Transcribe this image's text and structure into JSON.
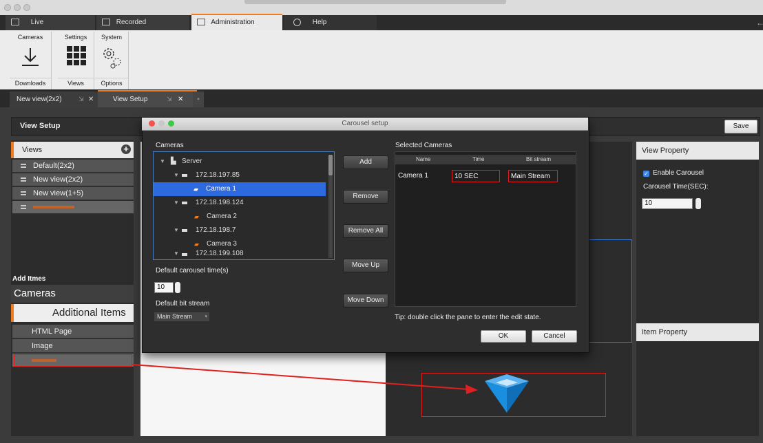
{
  "menu": {
    "tabs": [
      {
        "label": "Live"
      },
      {
        "label": "Recorded"
      },
      {
        "label": "Administration"
      },
      {
        "label": "Help"
      }
    ]
  },
  "ribbon": {
    "groups": [
      {
        "title": "Cameras",
        "icon": "download-icon",
        "footer": "Downloads"
      },
      {
        "title": "Settings",
        "icon": "views-grid-icon",
        "footer": "Views"
      },
      {
        "title": "System",
        "icon": "gears-icon",
        "footer": "Options"
      }
    ]
  },
  "doc_tabs": [
    {
      "label": "New view(2x2)"
    },
    {
      "label": "View Setup"
    }
  ],
  "view_setup": {
    "title": "View Setup",
    "save_label": "Save"
  },
  "left_panel": {
    "views_title": "Views",
    "views": [
      "Default(2x2)",
      "New view(2x2)",
      "New view(1+5)"
    ],
    "add_items_label": "Add Itmes",
    "cameras_label": "Cameras",
    "additional_items_label": "Additional Items",
    "additional_items": [
      "HTML Page",
      "Image"
    ]
  },
  "right_panel": {
    "view_property_title": "View Property",
    "enable_carousel_label": "Enable Carousel",
    "enable_carousel_checked": true,
    "carousel_time_label": "Carousel Time(SEC):",
    "carousel_time_value": "10",
    "item_property_title": "Item Property"
  },
  "dialog": {
    "title": "Carousel setup",
    "cameras_label": "Cameras",
    "tree": [
      {
        "label": "Server"
      },
      {
        "label": "172.18.197.85"
      },
      {
        "label": "Camera 1"
      },
      {
        "label": "172.18.198.124"
      },
      {
        "label": "Camera 2"
      },
      {
        "label": "172.18.198.7"
      },
      {
        "label": "Camera 3"
      },
      {
        "label": "172.18.199.108"
      }
    ],
    "buttons": {
      "add": "Add",
      "remove": "Remove",
      "remove_all": "Remove All",
      "move_up": "Move Up",
      "move_down": "Move Down",
      "ok": "OK",
      "cancel": "Cancel"
    },
    "default_time_label": "Default carousel time(s)",
    "default_time_value": "10",
    "default_bitstream_label": "Default bit stream",
    "default_bitstream_value": "Main Stream",
    "selected_label": "Selected Cameras",
    "selected_table": {
      "headers": [
        "Name",
        "Time",
        "Bit stream"
      ],
      "rows": [
        [
          "Camera 1",
          "10 SEC",
          "Main Stream"
        ]
      ]
    },
    "tip": "Tip: double click the pane to enter the edit state."
  },
  "colors": {
    "accent": "#f07a1e",
    "selection": "#2d6ae0",
    "annotation": "#e02020",
    "logo_blue": "#1a8fe0"
  }
}
